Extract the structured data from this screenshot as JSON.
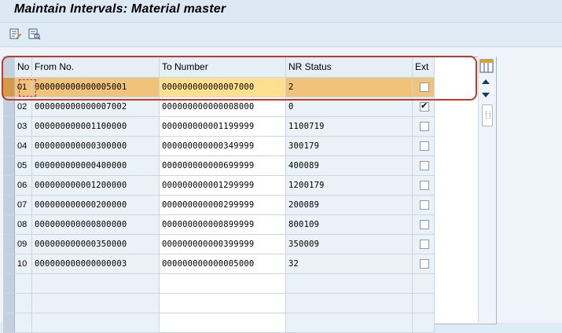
{
  "window": {
    "title": "Maintain Intervals: Material master"
  },
  "toolbar": {
    "buttons": [
      {
        "icon": "change-interval-icon"
      },
      {
        "icon": "display-interval-icon"
      }
    ]
  },
  "table": {
    "columns": [
      {
        "key": "no",
        "label": "No"
      },
      {
        "key": "from",
        "label": "From No."
      },
      {
        "key": "to",
        "label": "To Number"
      },
      {
        "key": "status",
        "label": "NR Status"
      },
      {
        "key": "ext",
        "label": "Ext"
      }
    ],
    "rows": [
      {
        "no": "01",
        "from": "000000000000005001",
        "to": "000000000000007000",
        "status": "2",
        "ext": false,
        "selected": true
      },
      {
        "no": "02",
        "from": "000000000000007002",
        "to": "000000000000008000",
        "status": "0",
        "ext": true
      },
      {
        "no": "03",
        "from": "000000000001100000",
        "to": "000000000001199999",
        "status": "1100719",
        "ext": false
      },
      {
        "no": "04",
        "from": "000000000000300000",
        "to": "000000000000349999",
        "status": "300179",
        "ext": false
      },
      {
        "no": "05",
        "from": "000000000000400000",
        "to": "000000000000699999",
        "status": "400089",
        "ext": false
      },
      {
        "no": "06",
        "from": "000000000001200000",
        "to": "000000000001299999",
        "status": "1200179",
        "ext": false
      },
      {
        "no": "07",
        "from": "000000000000200000",
        "to": "000000000000299999",
        "status": "200089",
        "ext": false
      },
      {
        "no": "08",
        "from": "000000000000800000",
        "to": "000000000000899999",
        "status": "800109",
        "ext": false
      },
      {
        "no": "09",
        "from": "000000000000350000",
        "to": "000000000000399999",
        "status": "350009",
        "ext": false
      },
      {
        "no": "10",
        "from": "000000000000000003",
        "to": "000000000000005000",
        "status": "32",
        "ext": false
      }
    ]
  },
  "colors": {
    "highlight": "#f0c27a",
    "annotation": "#c0392b"
  }
}
